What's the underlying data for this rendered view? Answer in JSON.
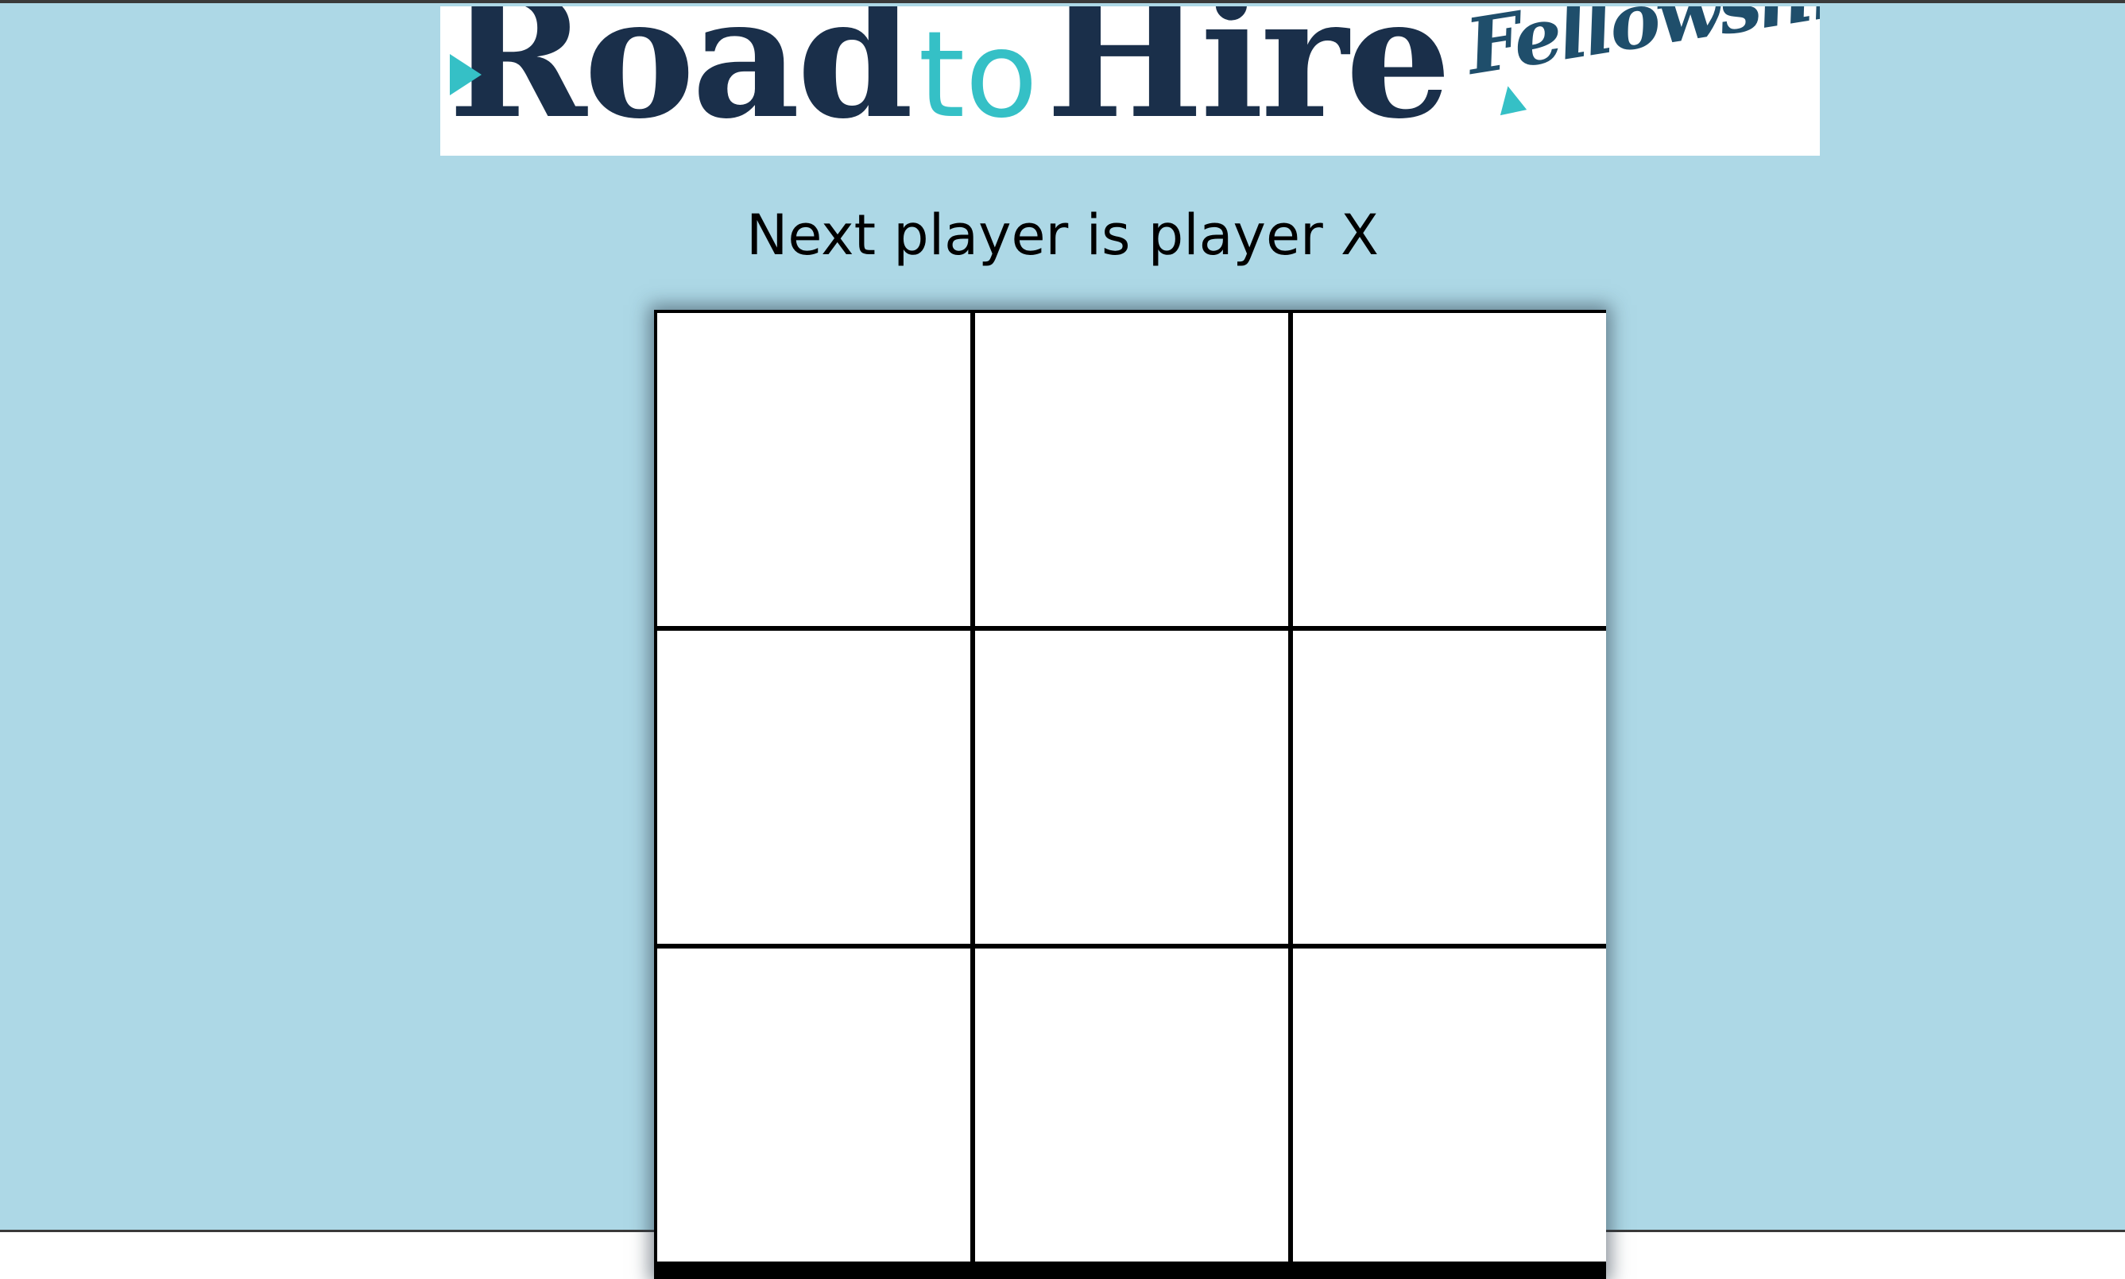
{
  "logo": {
    "word_road": "Road",
    "word_to": "to",
    "word_hire": "Hire",
    "word_fellowships": "Fellowships",
    "colors": {
      "navy": "#1a2f4a",
      "teal": "#35c0c6"
    }
  },
  "game": {
    "status_text": "Next player is player X",
    "next_player": "X",
    "board": [
      [
        "",
        "",
        ""
      ],
      [
        "",
        "",
        ""
      ],
      [
        "",
        "",
        ""
      ]
    ]
  },
  "colors": {
    "background": "#add8e6",
    "square": "#ffffff",
    "grid_lines": "#000000"
  }
}
